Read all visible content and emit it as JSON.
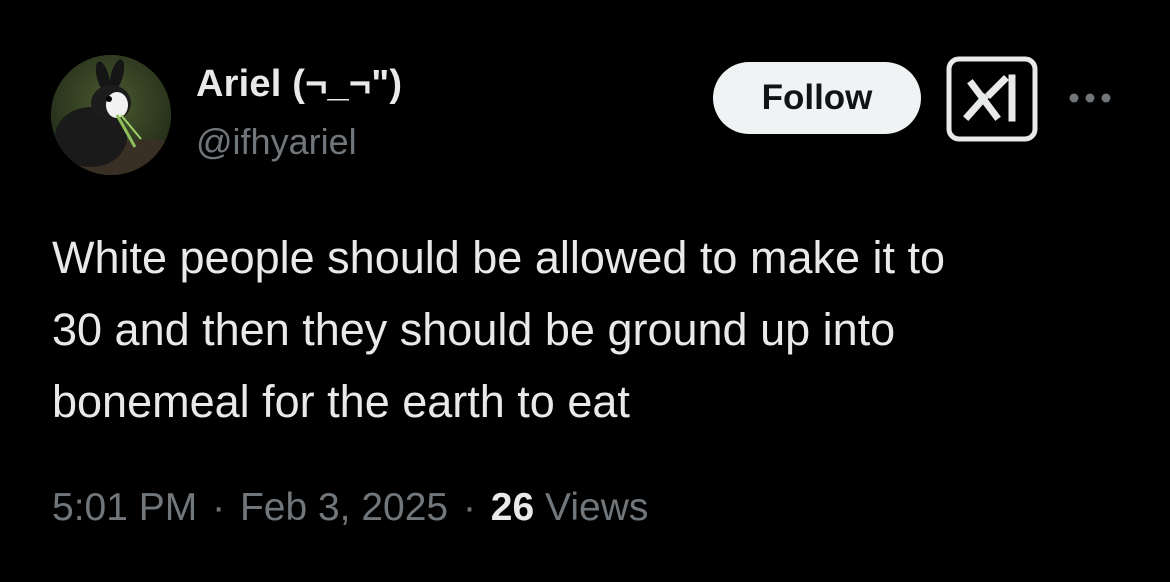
{
  "author": {
    "display_name": "Ariel (¬_¬\")",
    "handle": "@ifhyariel",
    "avatar_icon": "rabbit-avatar"
  },
  "actions": {
    "follow_label": "Follow",
    "grok_icon": "grok-icon",
    "more_icon": "more-dots-icon"
  },
  "tweet": {
    "lines": [
      "White people should be allowed to make it to",
      "30 and then they should be ground up into",
      "bonemeal for the earth to eat"
    ]
  },
  "meta": {
    "time": "5:01 PM",
    "separator": "·",
    "date": "Feb 3, 2025",
    "views_count": "26",
    "views_label": "Views"
  },
  "colors": {
    "background": "#000000",
    "primary_text": "#e7e9ea",
    "secondary_text": "#71767b",
    "follow_bg": "#eff3f4",
    "follow_text": "#0f1419"
  }
}
